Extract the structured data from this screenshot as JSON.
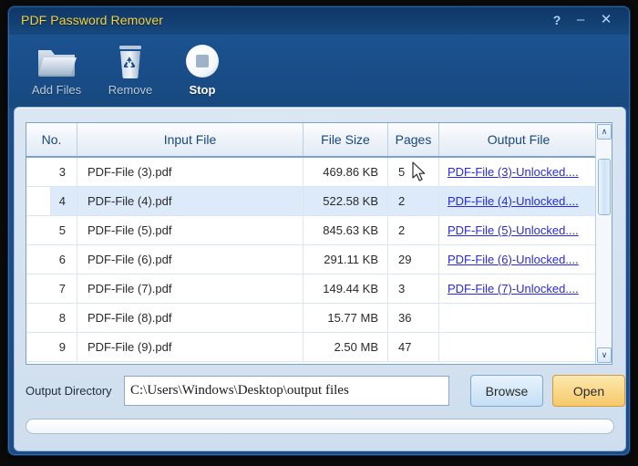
{
  "window": {
    "title": "PDF Password Remover",
    "controls": [
      {
        "name": "help",
        "glyph": "?"
      },
      {
        "name": "minimize",
        "glyph": "–"
      },
      {
        "name": "close",
        "glyph": "✕"
      }
    ]
  },
  "toolbar": {
    "add_files_label": "Add Files",
    "add_files_icon": "folder-icon",
    "remove_label": "Remove",
    "remove_icon": "recycle-bin-icon",
    "stop_label": "Stop",
    "stop_icon": "stop-circle-icon"
  },
  "table": {
    "columns": [
      "No.",
      "Input File",
      "File Size",
      "Pages",
      "Output File"
    ],
    "rows": [
      {
        "no": "3",
        "input": "PDF-File (3).pdf",
        "size": "469.86 KB",
        "pages": "5",
        "output": "PDF-File (3)-Unlocked....",
        "selected": false
      },
      {
        "no": "4",
        "input": "PDF-File (4).pdf",
        "size": "522.58 KB",
        "pages": "2",
        "output": "PDF-File (4)-Unlocked....",
        "selected": true
      },
      {
        "no": "5",
        "input": "PDF-File (5).pdf",
        "size": "845.63 KB",
        "pages": "2",
        "output": "PDF-File (5)-Unlocked....",
        "selected": false
      },
      {
        "no": "6",
        "input": "PDF-File (6).pdf",
        "size": "291.11 KB",
        "pages": "29",
        "output": "PDF-File (6)-Unlocked....",
        "selected": false
      },
      {
        "no": "7",
        "input": "PDF-File (7).pdf",
        "size": "149.44 KB",
        "pages": "3",
        "output": "PDF-File (7)-Unlocked....",
        "selected": false
      },
      {
        "no": "8",
        "input": "PDF-File (8).pdf",
        "size": "15.77 MB",
        "pages": "36",
        "output": "",
        "selected": false
      },
      {
        "no": "9",
        "input": "PDF-File (9).pdf",
        "size": "2.50 MB",
        "pages": "47",
        "output": "",
        "selected": false
      }
    ],
    "scrollbar": {
      "up_glyph": "∧",
      "down_glyph": "∨"
    }
  },
  "footer": {
    "output_directory_label": "Output Directory",
    "output_directory_value": "C:\\Users\\Windows\\Desktop\\output files",
    "browse_label": "Browse",
    "open_label": "Open"
  },
  "colors": {
    "title_text": "#f7d23c",
    "title_bar": "#123f72",
    "toolbar": "#1b5291",
    "panel": "#dae6f2",
    "header_text": "#17477f",
    "link": "#2a2ad6",
    "selection": "#dceafa",
    "browse_button": "#c5def5",
    "open_button": "#f6c96a"
  }
}
